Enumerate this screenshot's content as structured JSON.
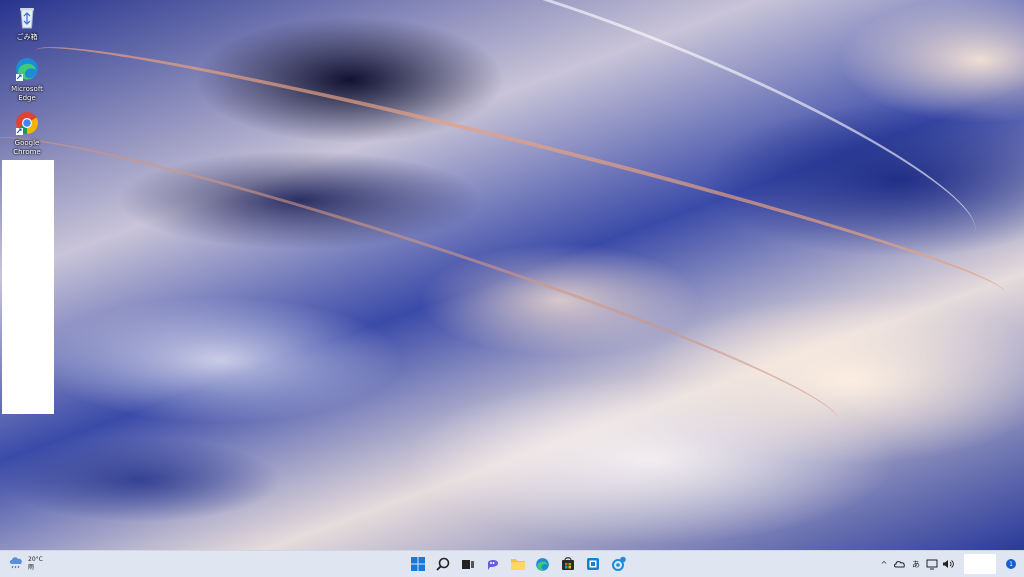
{
  "desktop": {
    "icons": [
      {
        "label": "ごみ箱",
        "icon": "recycle-bin-icon"
      },
      {
        "label": "Microsoft Edge",
        "icon": "edge-icon"
      },
      {
        "label": "Google Chrome",
        "icon": "chrome-icon"
      }
    ]
  },
  "taskbar": {
    "weather": {
      "temp": "20°C",
      "condition": "雨",
      "icon": "cloud-rain-icon"
    },
    "center_icons": [
      "windows-start-icon",
      "search-icon",
      "task-view-icon",
      "chat-icon",
      "file-explorer-icon",
      "edge-icon",
      "store-icon",
      "app-icon",
      "settings-icon"
    ],
    "tray": {
      "chevron": "^",
      "ime": "あ",
      "notification_count": "1"
    }
  },
  "colors": {
    "taskbar_bg": "#dfe6f1",
    "accent": "#1a5fd0"
  }
}
